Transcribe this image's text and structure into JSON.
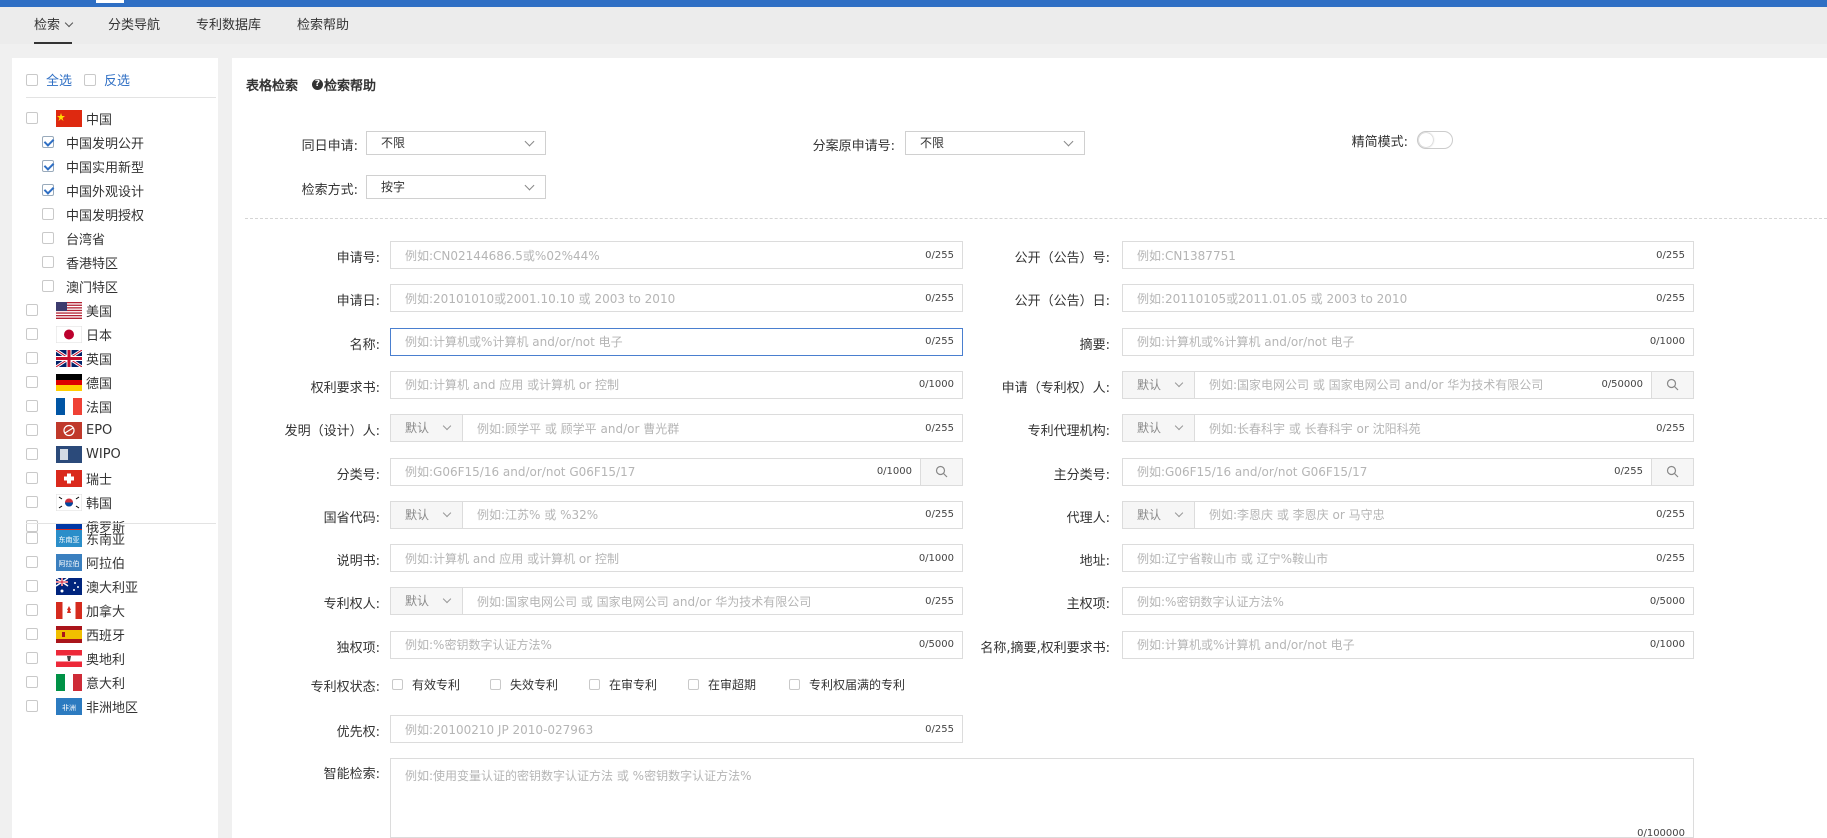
{
  "nav": {
    "items": [
      "检索",
      "分类导航",
      "专利数据库",
      "检索帮助"
    ]
  },
  "sidebar": {
    "select_all": "全选",
    "invert": "反选",
    "countries": [
      {
        "label": "中国",
        "flag": "cn",
        "checked": false,
        "sub": false
      },
      {
        "label": "中国发明公开",
        "checked": true,
        "sub": true
      },
      {
        "label": "中国实用新型",
        "checked": true,
        "sub": true
      },
      {
        "label": "中国外观设计",
        "checked": true,
        "sub": true
      },
      {
        "label": "中国发明授权",
        "checked": false,
        "sub": true
      },
      {
        "label": "台湾省",
        "checked": false,
        "sub": true
      },
      {
        "label": "香港特区",
        "checked": false,
        "sub": true
      },
      {
        "label": "澳门特区",
        "checked": false,
        "sub": true
      },
      {
        "label": "美国",
        "flag": "us",
        "checked": false,
        "sub": false
      },
      {
        "label": "日本",
        "flag": "jp",
        "checked": false,
        "sub": false
      },
      {
        "label": "英国",
        "flag": "gb",
        "checked": false,
        "sub": false
      },
      {
        "label": "德国",
        "flag": "de",
        "checked": false,
        "sub": false
      },
      {
        "label": "法国",
        "flag": "fr",
        "checked": false,
        "sub": false
      },
      {
        "label": "EPO",
        "flag": "epo",
        "checked": false,
        "sub": false
      },
      {
        "label": "WIPO",
        "flag": "wipo",
        "checked": false,
        "sub": false
      },
      {
        "label": "瑞士",
        "flag": "ch",
        "checked": false,
        "sub": false
      },
      {
        "label": "韩国",
        "flag": "kr",
        "checked": false,
        "sub": false
      },
      {
        "label": "俄罗斯",
        "flag": "ru",
        "checked": false,
        "sub": false
      }
    ],
    "regions": [
      {
        "label": "东南亚",
        "flag": "asean",
        "badge": "东南亚"
      },
      {
        "label": "阿拉伯",
        "flag": "arab",
        "badge": "阿拉伯"
      },
      {
        "label": "澳大利亚",
        "flag": "au"
      },
      {
        "label": "加拿大",
        "flag": "ca"
      },
      {
        "label": "西班牙",
        "flag": "es"
      },
      {
        "label": "奥地利",
        "flag": "at"
      },
      {
        "label": "意大利",
        "flag": "it"
      },
      {
        "label": "非洲地区",
        "flag": "africa",
        "badge": "非洲"
      }
    ]
  },
  "main": {
    "tab_title": "表格检索",
    "help_label": "检索帮助",
    "same_day": {
      "label": "同日申请:",
      "value": "不限"
    },
    "divisional": {
      "label": "分案原申请号:",
      "value": "不限"
    },
    "simple_mode": {
      "label": "精简模式:",
      "on": false
    },
    "search_method": {
      "label": "检索方式:",
      "value": "按字"
    },
    "left_fields": [
      {
        "label": "申请号:",
        "placeholder": "例如:CN02144686.5或%02%44%",
        "count": "0/255"
      },
      {
        "label": "申请日:",
        "placeholder": "例如:20101010或2001.10.10 或 2003 to 2010",
        "count": "0/255"
      },
      {
        "label": "名称:",
        "placeholder": "例如:计算机或%计算机 and/or/not 电子",
        "count": "0/255",
        "focus": true
      },
      {
        "label": "权利要求书:",
        "placeholder": "例如:计算机 and 应用 或计算机 or 控制",
        "count": "0/1000"
      },
      {
        "label": "发明（设计）人:",
        "prefix": "默认",
        "placeholder": "例如:顾学平 或 顾学平 and/or 曹光群",
        "count": "0/255"
      },
      {
        "label": "分类号:",
        "placeholder": "例如:G06F15/16 and/or/not G06F15/17",
        "count": "0/1000",
        "search": true
      },
      {
        "label": "国省代码:",
        "prefix": "默认",
        "placeholder": "例如:江苏% 或 %32%",
        "count": "0/255"
      },
      {
        "label": "说明书:",
        "placeholder": "例如:计算机 and 应用 或计算机 or 控制",
        "count": "0/1000"
      },
      {
        "label": "专利权人:",
        "prefix": "默认",
        "placeholder": "例如:国家电网公司 或 国家电网公司 and/or 华为技术有限公司",
        "count": "0/255"
      },
      {
        "label": "独权项:",
        "placeholder": "例如:%密钥数字认证方法%",
        "count": "0/5000"
      }
    ],
    "right_fields": [
      {
        "label": "公开（公告）号:",
        "placeholder": "例如:CN1387751",
        "count": "0/255"
      },
      {
        "label": "公开（公告）日:",
        "placeholder": "例如:20110105或2011.01.05 或 2003 to 2010",
        "count": "0/255"
      },
      {
        "label": "摘要:",
        "placeholder": "例如:计算机或%计算机 and/or/not 电子",
        "count": "0/1000"
      },
      {
        "label": "申请（专利权）人:",
        "prefix": "默认",
        "placeholder": "例如:国家电网公司 或 国家电网公司 and/or 华为技术有限公司",
        "count": "0/50000",
        "search": true
      },
      {
        "label": "专利代理机构:",
        "prefix": "默认",
        "placeholder": "例如:长春科宇 或 长春科宇 or 沈阳科苑",
        "count": "0/255"
      },
      {
        "label": "主分类号:",
        "placeholder": "例如:G06F15/16 and/or/not G06F15/17",
        "count": "0/255",
        "search": true
      },
      {
        "label": "代理人:",
        "prefix": "默认",
        "placeholder": "例如:李恩庆 或 李恩庆 or 马守忠",
        "count": "0/255"
      },
      {
        "label": "地址:",
        "placeholder": "例如:辽宁省鞍山市 或 辽宁%鞍山市",
        "count": "0/255"
      },
      {
        "label": "主权项:",
        "placeholder": "例如:%密钥数字认证方法%",
        "count": "0/5000"
      },
      {
        "label": "名称,摘要,权利要求书:",
        "placeholder": "例如:计算机或%计算机 and/or/not 电子",
        "count": "0/1000"
      }
    ],
    "status": {
      "label": "专利权状态:",
      "options": [
        "有效专利",
        "失效专利",
        "在审专利",
        "在审超期",
        "专利权届满的专利"
      ]
    },
    "priority": {
      "label": "优先权:",
      "placeholder": "例如:20100210 JP 2010-027963",
      "count": "0/255"
    },
    "smart": {
      "label": "智能检索:",
      "placeholder": "例如:使用变量认证的密钥数字认证方法 或 %密钥数字认证方法%",
      "count": "0/100000"
    }
  }
}
